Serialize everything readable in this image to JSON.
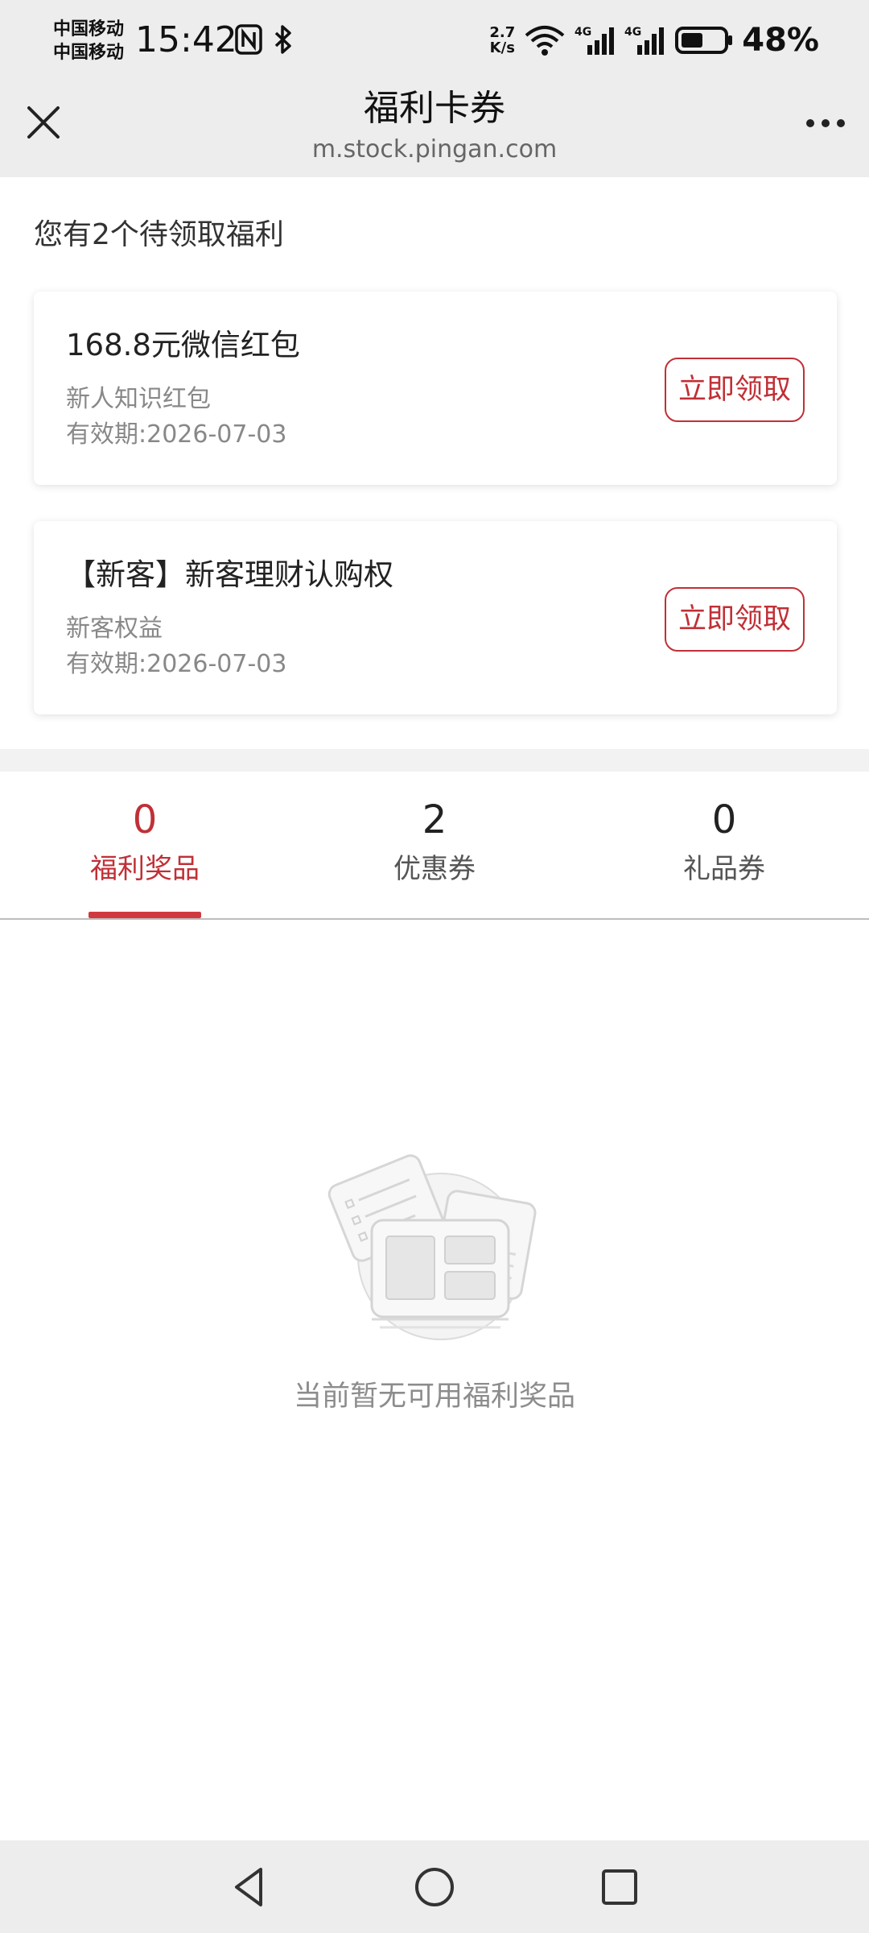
{
  "status_bar": {
    "carrier_1": "中国移动",
    "carrier_2": "中国移动",
    "time": "15:42",
    "speed_value": "2.7",
    "speed_unit": "K/s",
    "battery_percent": "48%"
  },
  "title_bar": {
    "title": "福利卡券",
    "url": "m.stock.pingan.com"
  },
  "pending": {
    "heading": "您有2个待领取福利",
    "cards": [
      {
        "title": "168.8元微信红包",
        "subtitle": "新人知识红包",
        "expiry": "有效期:2026-07-03",
        "button": "立即领取"
      },
      {
        "title": "【新客】新客理财认购权",
        "subtitle": "新客权益",
        "expiry": "有效期:2026-07-03",
        "button": "立即领取"
      }
    ]
  },
  "tabs": [
    {
      "count": "0",
      "label": "福利奖品",
      "active": true
    },
    {
      "count": "2",
      "label": "优惠券",
      "active": false
    },
    {
      "count": "0",
      "label": "礼品券",
      "active": false
    }
  ],
  "empty_state": {
    "message": "当前暂无可用福利奖品"
  },
  "colors": {
    "accent": "#c03036",
    "bar_background": "#ededed"
  }
}
